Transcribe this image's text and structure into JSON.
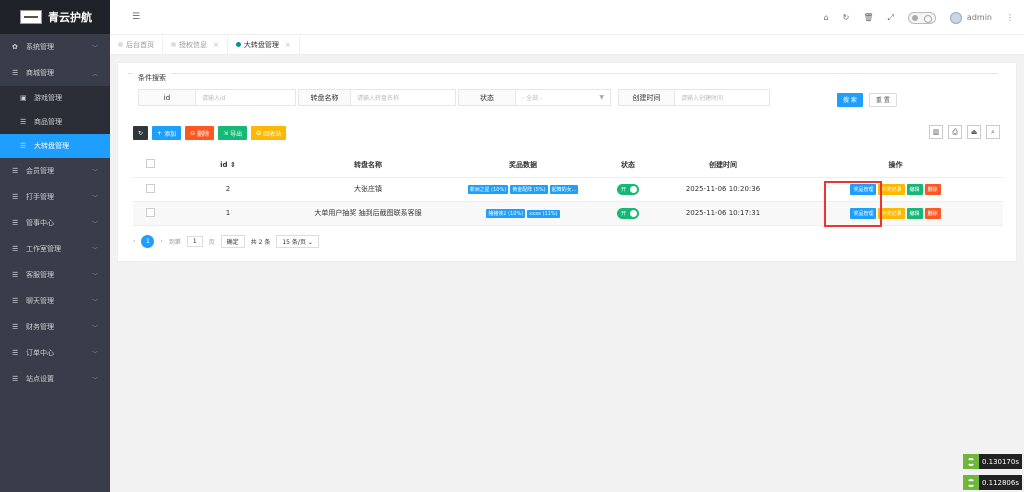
{
  "app": {
    "title": "青云护航"
  },
  "sidebar": {
    "items": [
      {
        "label": "系统管理",
        "icon": "gear-icon"
      },
      {
        "label": "商城管理",
        "icon": "list-icon",
        "open": true
      },
      {
        "label": "会员管理",
        "icon": "list-icon"
      },
      {
        "label": "打手管理",
        "icon": "list-icon"
      },
      {
        "label": "管事中心",
        "icon": "list-icon"
      },
      {
        "label": "工作室管理",
        "icon": "list-icon"
      },
      {
        "label": "客服管理",
        "icon": "list-icon"
      },
      {
        "label": "聊天管理",
        "icon": "list-icon"
      },
      {
        "label": "财务管理",
        "icon": "list-icon"
      },
      {
        "label": "订单中心",
        "icon": "list-icon"
      },
      {
        "label": "站点设置",
        "icon": "list-icon"
      }
    ],
    "sub_items": [
      {
        "label": "游戏管理"
      },
      {
        "label": "商品管理"
      },
      {
        "label": "大转盘管理",
        "active": true
      }
    ]
  },
  "header": {
    "username": "admin"
  },
  "tabs": [
    {
      "label": "后台首页"
    },
    {
      "label": "授权信息"
    },
    {
      "label": "大转盘管理",
      "active": true
    }
  ],
  "search": {
    "legend": "条件搜索",
    "id_label": "id",
    "id_placeholder": "请输入id",
    "name_label": "转盘名称",
    "name_placeholder": "请输入转盘名称",
    "status_label": "状态",
    "status_value": "- 全部 -",
    "time_label": "创建时间",
    "time_placeholder": "请输入创建时间",
    "search_btn": "搜 索",
    "reset_btn": "重 置"
  },
  "toolbar": {
    "add": "添加",
    "delete": "删除",
    "export": "导出",
    "recycle": "回收站"
  },
  "table": {
    "headers": [
      "id ⇕",
      "转盘名称",
      "奖品数据",
      "状态",
      "创建时间",
      "操作"
    ],
    "rows": [
      {
        "id": "2",
        "name": "大张庄镇",
        "prizes": [
          "菲洲之星 (10%)",
          "黄金配阵 (5%)",
          "起舞的女..."
        ],
        "status": "开",
        "created": "2025-11-06 10:20:36"
      },
      {
        "id": "1",
        "name": "大单用户抽奖 抽到后截图联系客服",
        "prizes": [
          "猪猪侠2 (10%)",
          "xxxx (11%)"
        ],
        "status": "开",
        "created": "2025-11-06 10:17:31"
      }
    ],
    "ops": {
      "prize": "奖品管理",
      "record": "中奖记录",
      "edit": "编辑",
      "del": "删除"
    }
  },
  "pager": {
    "current": "1",
    "goto": "到第",
    "page_value": "1",
    "page_unit": "页",
    "confirm": "确定",
    "total": "共 2 条",
    "per_page": "15 条/页"
  },
  "perf": [
    "0.130170s",
    "0.112806s"
  ]
}
